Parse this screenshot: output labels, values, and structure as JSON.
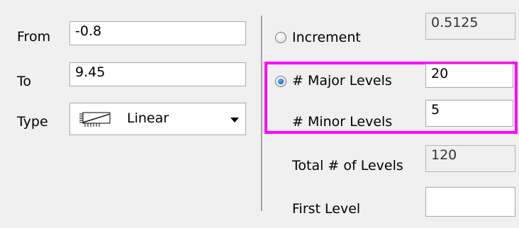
{
  "left_panel": {
    "from": {
      "label": "From",
      "value": "-0.8"
    },
    "to": {
      "label": "To",
      "value": "9.45"
    },
    "type": {
      "label": "Type",
      "value": "Linear",
      "icon": "linear-scale-icon"
    }
  },
  "right_panel": {
    "increment": {
      "label": "Increment",
      "value": "0.5125",
      "selected": false
    },
    "major_levels": {
      "label": "# Major Levels",
      "value": "20",
      "selected": true
    },
    "minor_levels": {
      "label": "# Minor Levels",
      "value": "5"
    },
    "total_levels": {
      "label": "Total # of Levels",
      "value": "120"
    },
    "first_level": {
      "label": "First Level",
      "value": ""
    }
  },
  "colors": {
    "highlight": "#ff00ff",
    "radio_selected": "#1f6fd0"
  }
}
